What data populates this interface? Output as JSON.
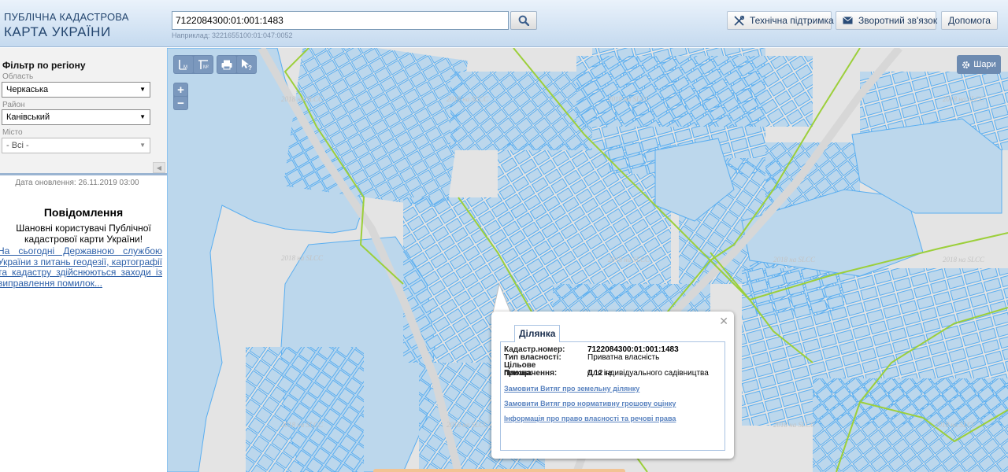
{
  "header": {
    "logo_line1": "ПУБЛІЧНА КАДАСТРОВА",
    "logo_line2": "КАРТА УКРАЇНИ",
    "search_value": "7122084300:01:001:1483",
    "search_example": "Наприклад: 3221655100:01:047:0052",
    "btn_support": "Технічна підтримка",
    "btn_feedback": "Зворотний зв'язок",
    "btn_help": "Допомога"
  },
  "filter": {
    "title": "Фільтр по регіону",
    "oblast_label": "Область",
    "oblast_value": "Черкаська",
    "rayon_label": "Район",
    "rayon_value": "Канівський",
    "misto_label": "Місто",
    "misto_value": "- Всі -"
  },
  "sidebar": {
    "update_date": "Дата оновлення: 26.11.2019 03:00",
    "notice_title": "Повідомлення",
    "notice_text": "Шановні користувачі Публічної кадастрової карти України!",
    "notice_link": "На сьогодні Державною службою України з питань геодезії, картографії та кадастру здійснюються заходи із виправлення помилок..."
  },
  "map": {
    "layers_label": "Шари",
    "watermark": "2018 на SLCC",
    "popup": {
      "tab": "Ділянка",
      "rows": [
        {
          "k": "Кадастр.номер:",
          "v": "7122084300:01:001:1483"
        },
        {
          "k": "Тип власності:",
          "v": "Приватна власність"
        },
        {
          "k": "Цільове призначення:",
          "v": "Для індивідуального садівництва"
        },
        {
          "k": "Площа:",
          "v": "0.12 га"
        }
      ],
      "links": [
        "Замовити Витяг про земельну ділянку",
        "Замовити Витяг про нормативну грошову оцінку",
        "Інформація про право власності та речові права"
      ]
    }
  },
  "colors": {
    "water": "#bcd7ec",
    "parcel_stroke": "#5aaef0",
    "boundary": "#9ccf3a",
    "toolbar": "#6d8bb1"
  }
}
